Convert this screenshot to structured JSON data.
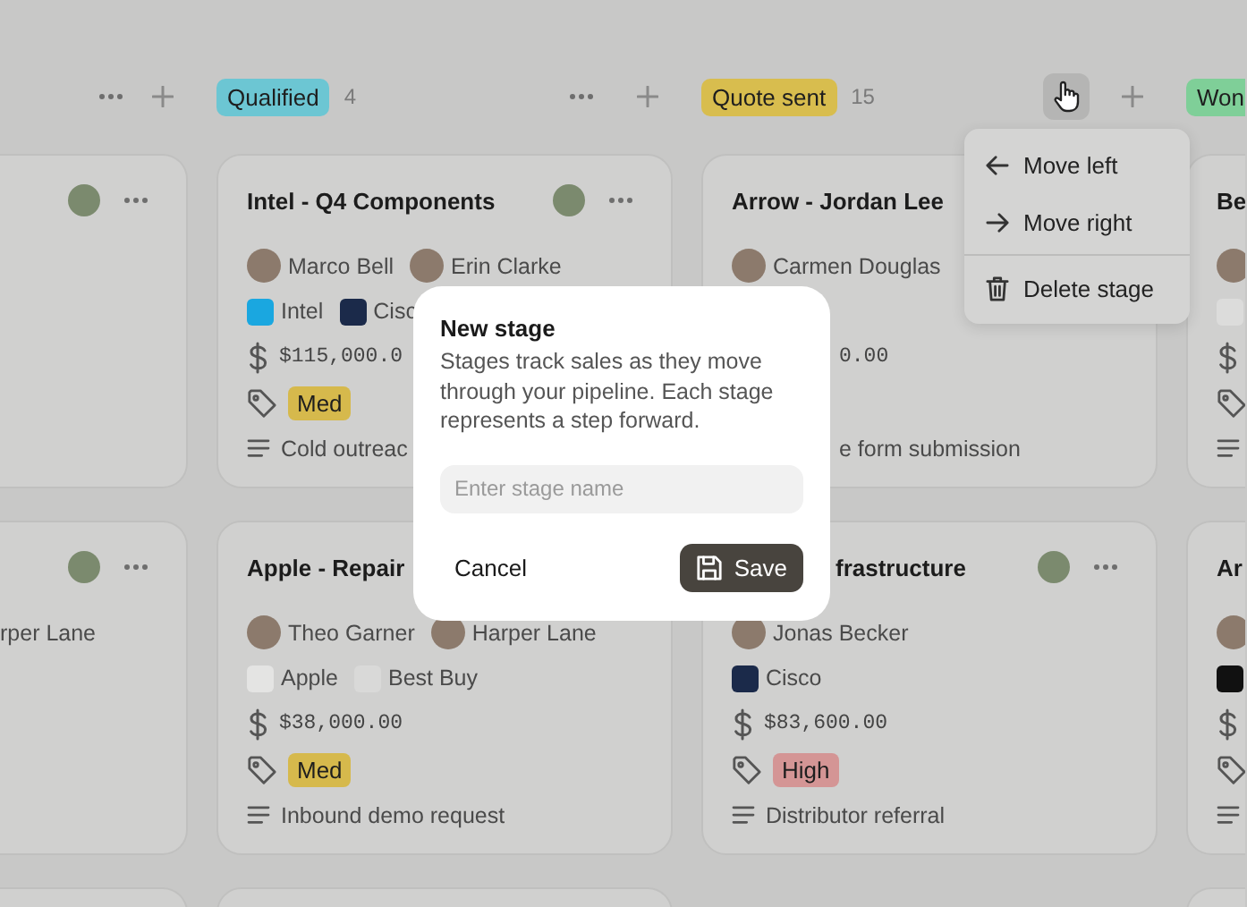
{
  "columns": [
    {
      "kind": "cut_left",
      "menu_open": false,
      "cards": [
        {
          "kind": "card"
        },
        {
          "kind": "card",
          "rows": [
            {
              "kind": "people",
              "people": [
                {
                  "name": "rper Lane"
                }
              ]
            }
          ]
        },
        {
          "kind": "stub"
        }
      ]
    },
    {
      "kind": "full",
      "header": {
        "label": "Qualified",
        "color": "#6cc6d3",
        "count": "4"
      },
      "menu_open": false,
      "cards": [
        {
          "kind": "card",
          "title": "Intel - Q4 Components",
          "rows": [
            {
              "kind": "people",
              "people": [
                {
                  "name": "Marco Bell"
                },
                {
                  "name": "Erin Clarke"
                }
              ]
            },
            {
              "kind": "companies",
              "companies": [
                {
                  "name": "Intel",
                  "color": "#1aa7e0"
                },
                {
                  "name": "Cisc",
                  "color": "#1b2a4a"
                }
              ]
            },
            {
              "kind": "amount",
              "text": "$115,000.0"
            },
            {
              "kind": "tag",
              "text": "Med",
              "color": "#d6b94c"
            },
            {
              "kind": "note",
              "text": "Cold outreac"
            }
          ]
        },
        {
          "kind": "card",
          "title": "Apple - Repair",
          "rows": [
            {
              "kind": "people",
              "people": [
                {
                  "name": "Theo Garner"
                },
                {
                  "name": "Harper Lane"
                }
              ]
            },
            {
              "kind": "companies",
              "companies": [
                {
                  "name": "Apple",
                  "color": "#e4e4e3"
                },
                {
                  "name": "Best Buy",
                  "color": "#d9d9d8"
                }
              ]
            },
            {
              "kind": "amount",
              "text": "$38,000.00"
            },
            {
              "kind": "tag",
              "text": "Med",
              "color": "#d6b94c"
            },
            {
              "kind": "note",
              "text": "Inbound demo request"
            }
          ]
        },
        {
          "kind": "stub"
        }
      ]
    },
    {
      "kind": "full",
      "header": {
        "label": "Quote sent",
        "color": "#d8bd4e",
        "count": "15"
      },
      "menu_open": true,
      "cards": [
        {
          "kind": "card",
          "title": "Arrow - Jordan Lee",
          "rows": [
            {
              "kind": "people",
              "people": [
                {
                  "name": "Carmen Douglas"
                }
              ]
            },
            {
              "kind": "amount",
              "text": "0.00",
              "covered": true
            },
            {
              "kind": "note",
              "text": "e form submission",
              "covered": true
            }
          ]
        },
        {
          "kind": "card",
          "title": "frastructure",
          "title_covered": true,
          "rows": [
            {
              "kind": "people",
              "people": [
                {
                  "name": "Jonas Becker"
                }
              ]
            },
            {
              "kind": "companies",
              "companies": [
                {
                  "name": "Cisco",
                  "color": "#1b2a4a"
                }
              ]
            },
            {
              "kind": "amount",
              "text": "$83,600.00"
            },
            {
              "kind": "tag",
              "text": "High",
              "color": "#d49595"
            },
            {
              "kind": "note",
              "text": "Distributor referral"
            }
          ]
        }
      ]
    },
    {
      "kind": "cut_right",
      "header": {
        "label": "Won",
        "color": "#7fcf98"
      },
      "cards": [
        {
          "kind": "card",
          "title": "Be",
          "rows": [
            {
              "kind": "people"
            },
            {
              "kind": "companies",
              "companies": [
                {
                  "color": "#dcdcdb"
                }
              ]
            },
            {
              "kind": "amount"
            },
            {
              "kind": "tag"
            },
            {
              "kind": "note"
            }
          ]
        },
        {
          "kind": "card",
          "title": "Ar",
          "rows": [
            {
              "kind": "people"
            },
            {
              "kind": "companies",
              "companies": [
                {
                  "color": "#111111"
                }
              ]
            },
            {
              "kind": "amount"
            },
            {
              "kind": "tag"
            },
            {
              "kind": "note"
            }
          ]
        },
        {
          "kind": "stub"
        }
      ]
    }
  ],
  "stage_menu": [
    {
      "kind": "left",
      "label": "Move left"
    },
    {
      "kind": "right",
      "label": "Move right"
    },
    {
      "kind": "delete",
      "label": "Delete stage"
    }
  ],
  "dialog": {
    "title": "New stage",
    "description": "Stages track sales as they move through your pipeline. Each stage represents a step forward.",
    "placeholder": "Enter stage name",
    "cancel": "Cancel",
    "save": "Save"
  }
}
